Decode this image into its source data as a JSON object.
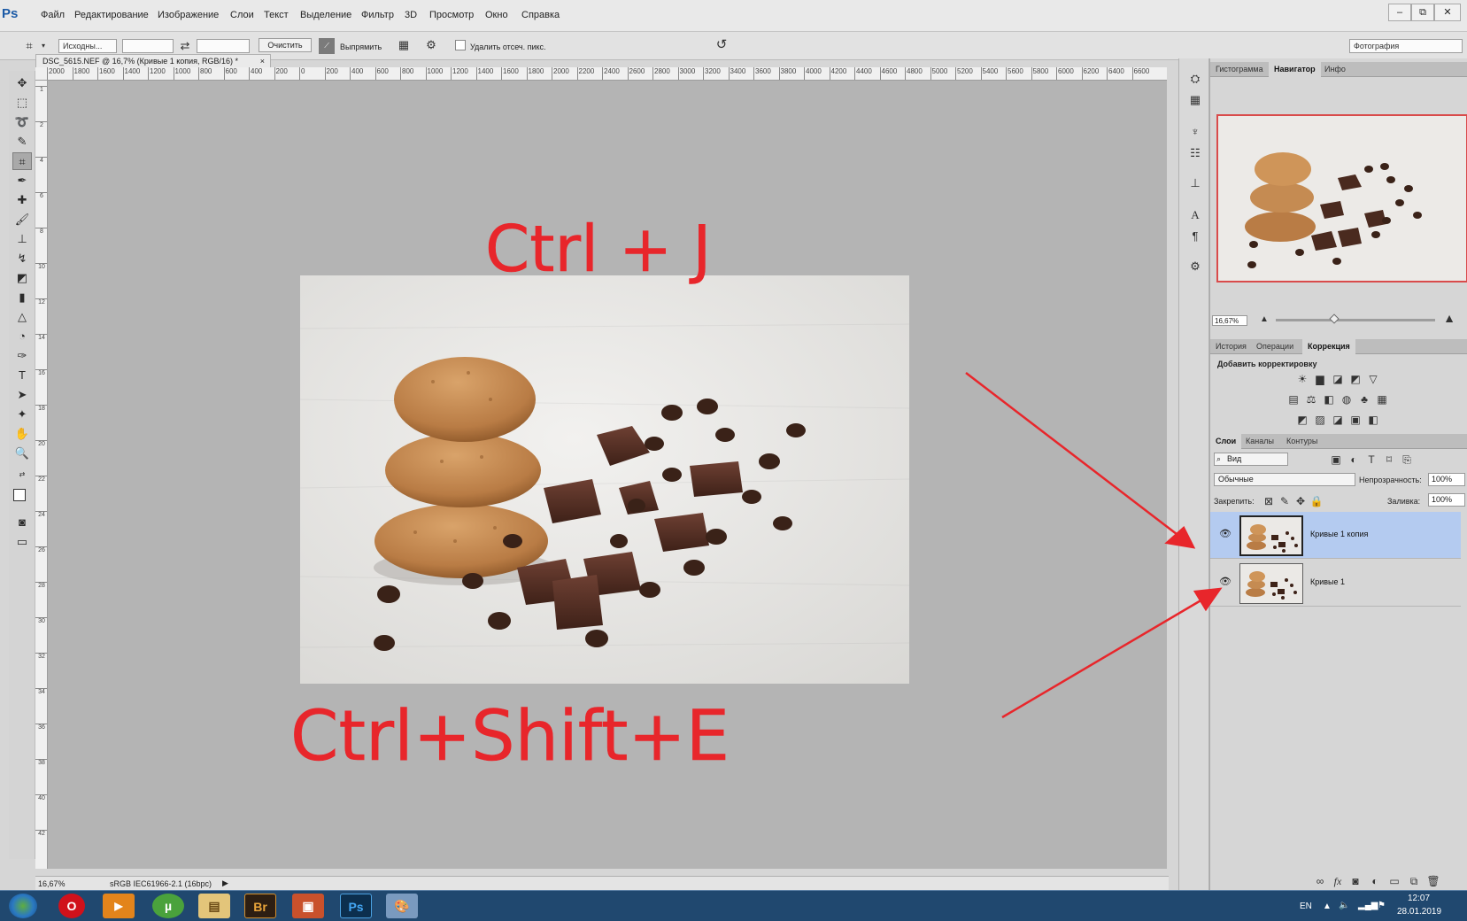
{
  "menubar": {
    "logo": "Ps",
    "items": [
      "Файл",
      "Редактирование",
      "Изображение",
      "Слои",
      "Текст",
      "Выделение",
      "Фильтр",
      "3D",
      "Просмотр",
      "Окно",
      "Справка"
    ],
    "window_controls": {
      "minimize": "–",
      "restore": "⧉",
      "close": "✕"
    }
  },
  "options": {
    "ratio_select": "Исходны...",
    "clear_label": "Очистить",
    "straighten_label": "Выпрямить",
    "delete_cropped_label": "Удалить отсеч. пикс.",
    "workspace": "Фотография"
  },
  "document": {
    "tab_title": "DSC_5615.NEF @ 16,7% (Кривые 1 копия, RGB/16) *",
    "tab_close": "×",
    "ruler_top": [
      "2000",
      "1800",
      "1600",
      "1400",
      "1200",
      "1000",
      "800",
      "600",
      "400",
      "200",
      "0",
      "200",
      "400",
      "600",
      "800",
      "1000",
      "1200",
      "1400",
      "1600",
      "1800",
      "2000",
      "2200",
      "2400",
      "2600",
      "2800",
      "3000",
      "3200",
      "3400",
      "3600",
      "3800",
      "4000",
      "4200",
      "4400",
      "4600",
      "4800",
      "5000",
      "5200",
      "5400",
      "5600",
      "5800",
      "6000",
      "6200",
      "6400",
      "6600"
    ],
    "ruler_left": [
      "1",
      "2",
      "4",
      "6",
      "8",
      "10",
      "12",
      "14",
      "16",
      "18",
      "20",
      "22",
      "24",
      "26",
      "28",
      "30",
      "32",
      "34",
      "36",
      "38",
      "40",
      "42"
    ]
  },
  "status": {
    "zoom": "16,67%",
    "profile": "sRGB IEC61966-2.1 (16bpc)"
  },
  "annotations": {
    "top": "Ctrl + J",
    "bottom": "Ctrl+Shift+E"
  },
  "navigator": {
    "tabs": [
      "Гистограмма",
      "Навигатор",
      "Инфо"
    ],
    "zoom": "16,67%"
  },
  "adjustments": {
    "tabs": [
      "История",
      "Операции",
      "Коррекция"
    ],
    "title": "Добавить корректировку"
  },
  "layers": {
    "tabs": [
      "Слои",
      "Каналы",
      "Контуры"
    ],
    "filter": "Вид",
    "blend_mode": "Обычные",
    "opacity_label": "Непрозрачность:",
    "opacity_value": "100%",
    "lock_label": "Закрепить:",
    "fill_label": "Заливка:",
    "fill_value": "100%",
    "items": [
      {
        "name": "Кривые 1 копия",
        "selected": true
      },
      {
        "name": "Кривые 1",
        "selected": false
      }
    ]
  },
  "taskbar": {
    "lang": "EN",
    "time": "12:07",
    "date": "28.01.2019",
    "apps": [
      "Br",
      "Ps"
    ]
  }
}
